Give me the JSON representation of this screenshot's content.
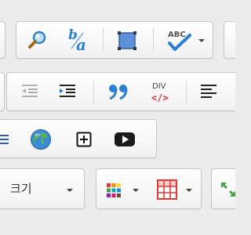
{
  "toolbar": {
    "row1": {
      "find_icon": "magnifier-icon",
      "replace_icon": "find-replace-icon",
      "select_all_icon": "select-all-icon",
      "spellcheck_icon": "spellcheck-icon",
      "spellcheck_label": "ABC"
    },
    "row2": {
      "outdent_icon": "outdent-icon",
      "indent_icon": "indent-icon",
      "blockquote_icon": "blockquote-icon",
      "creatediv_icon": "create-div-icon",
      "creatediv_label": "DIV",
      "creatediv_tag": "</>",
      "align_left_icon": "align-left-icon"
    },
    "row3": {
      "list_icon": "list-icon",
      "link_globe_icon": "globe-icon",
      "add_icon": "plus-box-icon",
      "youtube_icon": "youtube-icon"
    },
    "row4": {
      "size_label": "크기",
      "text_color_icon": "color-grid-icon",
      "table_icon": "table-icon",
      "maximize_icon": "maximize-icon"
    }
  },
  "colors": {
    "toolbar_bg": "#ececec",
    "group_border": "#c6c6c6",
    "blue_accent": "#2d7fd3",
    "red_accent": "#d32f2f"
  }
}
